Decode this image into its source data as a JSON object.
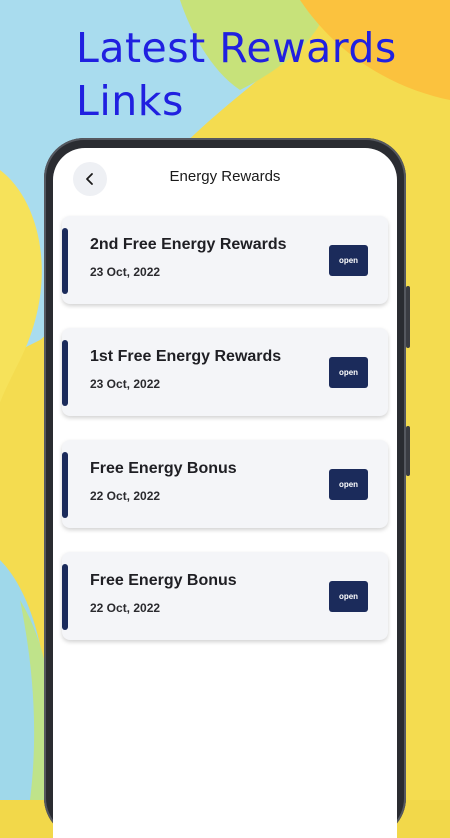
{
  "headline": {
    "line1": "Latest Rewards",
    "line2": "Links"
  },
  "topbar": {
    "title": "Energy Rewards",
    "back_icon": "chevron-left-icon"
  },
  "rewards": [
    {
      "title": "2nd Free Energy Rewards",
      "date": "23 Oct, 2022",
      "button": "open"
    },
    {
      "title": "1st Free Energy Rewards",
      "date": "23 Oct, 2022",
      "button": "open"
    },
    {
      "title": "Free Energy Bonus",
      "date": "22 Oct, 2022",
      "button": "open"
    },
    {
      "title": "Free Energy Bonus",
      "date": "22 Oct, 2022",
      "button": "open"
    }
  ],
  "colors": {
    "headline": "#2020e0",
    "accent": "#1b2b5b",
    "card_bg": "#f4f5f8",
    "background_yellow": "#f2d84a",
    "background_blue": "#a7dcef"
  }
}
